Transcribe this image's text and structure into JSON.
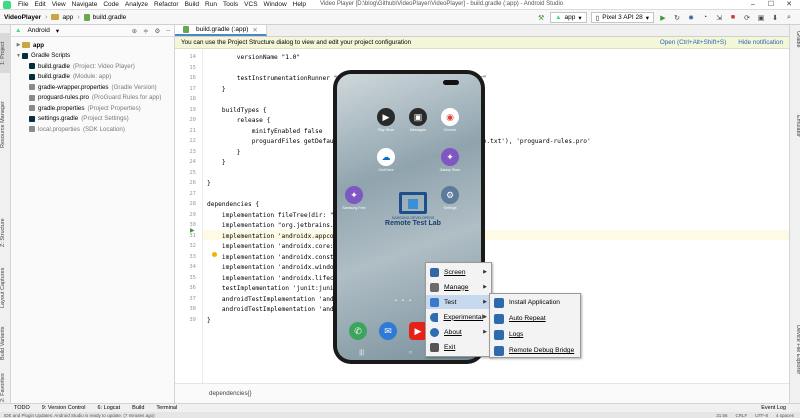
{
  "menubar": {
    "items": [
      "File",
      "Edit",
      "View",
      "Navigate",
      "Code",
      "Analyze",
      "Refactor",
      "Build",
      "Run",
      "Tools",
      "VCS",
      "Window",
      "Help"
    ],
    "window_title": "Video Player [D:\\blog\\Github\\VideoPlayer\\VideoPlayer] - build.gradle (:app) - Android Studio"
  },
  "navbar": {
    "project": "VideoPlayer",
    "module": "app",
    "file": "build.gradle",
    "run_config": "app",
    "device": "Pixel 3 API 28"
  },
  "project_panel": {
    "view_mode": "Android",
    "items": [
      {
        "label": "app",
        "note": "",
        "depth": 0
      },
      {
        "label": "Gradle Scripts",
        "note": "",
        "depth": 0
      },
      {
        "label": "build.gradle",
        "note": "(Project: Video Player)",
        "depth": 1
      },
      {
        "label": "build.gradle",
        "note": "(Module: app)",
        "depth": 1
      },
      {
        "label": "gradle-wrapper.properties",
        "note": "(Gradle Version)",
        "depth": 1
      },
      {
        "label": "proguard-rules.pro",
        "note": "(ProGuard Rules for app)",
        "depth": 1
      },
      {
        "label": "gradle.properties",
        "note": "(Project Properties)",
        "depth": 1
      },
      {
        "label": "settings.gradle",
        "note": "(Project Settings)",
        "depth": 1
      },
      {
        "label": "local.properties",
        "note": "(SDK Location)",
        "depth": 1
      }
    ]
  },
  "left_strip": [
    "1: Project",
    "Resource Manager",
    "Z: Structure",
    "Layout Captures",
    "Build Variants",
    "2: Favorites"
  ],
  "right_strip": [
    "Gradle",
    "Emulator",
    "Device File Explorer"
  ],
  "editor": {
    "tab_label": "build.gradle (:app)",
    "notice": "You can use the Project Structure dialog to view and edit your project configuration",
    "notice_links": [
      "Open (Ctrl+Alt+Shift+S)",
      "Hide notification"
    ],
    "lines": [
      {
        "n": "14",
        "text": "        versionName \"1.0\""
      },
      {
        "n": "15",
        "text": ""
      },
      {
        "n": "16",
        "text": "        testInstrumentationRunner \"androidx.test.runner.AndroidJUnitRunner\""
      },
      {
        "n": "17",
        "text": "    }"
      },
      {
        "n": "18",
        "text": ""
      },
      {
        "n": "19",
        "text": "    buildTypes {"
      },
      {
        "n": "20",
        "text": "        release {"
      },
      {
        "n": "21",
        "text": "            minifyEnabled false"
      },
      {
        "n": "22",
        "text": "            proguardFiles getDefaultProguardFile('proguard-android-optimize.txt'), 'proguard-rules.pro'"
      },
      {
        "n": "23",
        "text": "        }"
      },
      {
        "n": "24",
        "text": "    }"
      },
      {
        "n": "25",
        "text": ""
      },
      {
        "n": "26",
        "text": "}"
      },
      {
        "n": "27",
        "text": ""
      },
      {
        "n": "28",
        "text": "dependencies {"
      },
      {
        "n": "29",
        "text": "    implementation fileTree(dir: \"libs\", include: [\"*.jar\"])"
      },
      {
        "n": "30",
        "text": "    implementation \"org.jetbrains.kotlin:kotlin-stdlib:$kotlin_version\""
      },
      {
        "n": "31",
        "text": "    implementation 'androidx.appcompat:appcompat:1.2.0'"
      },
      {
        "n": "32",
        "text": "    implementation 'androidx.core:core-ktx:1.3.1'"
      },
      {
        "n": "33",
        "text": "    implementation 'androidx.constraintlayout:constraintlayout:2.0.1'"
      },
      {
        "n": "34",
        "text": "    implementation 'androidx.window:window:1.0.0'"
      },
      {
        "n": "35",
        "text": "    implementation 'androidx.lifecycle:lifecycle-runtime:2.2.0'"
      },
      {
        "n": "36",
        "text": "    testImplementation 'junit:junit:4.12'"
      },
      {
        "n": "37",
        "text": "    androidTestImplementation 'androidx.test.ext:junit:1.1.2'"
      },
      {
        "n": "38",
        "text": "    androidTestImplementation 'androidx.test.espresso:espresso-core:3.3.0'"
      },
      {
        "n": "39",
        "text": "}"
      }
    ],
    "bottom_crumb": "dependencies{}"
  },
  "bottom_tools": [
    "TODO",
    "9: Version Control",
    "6: Logcat",
    "Build",
    "Terminal"
  ],
  "event_log": "Event Log",
  "status": {
    "message": "IDE and Plugin Updates: Android Studio is ready to update. (7 minutes ago)",
    "position": "31:56",
    "line_sep": "CRLF",
    "encoding": "UTF-8",
    "indent": "4 spaces"
  },
  "phone": {
    "apps": [
      {
        "label": "Play Store",
        "color": "#2a2a2a",
        "glyph": "▶"
      },
      {
        "label": "Messages",
        "color": "#2a2a2a",
        "glyph": "▣"
      },
      {
        "label": "Chrome",
        "color": "#ffffff",
        "glyph": "◉"
      },
      {
        "label": "OneDrive",
        "color": "#ffffff",
        "glyph": "☁"
      },
      {
        "label": "Samsung Free",
        "color": "#7e57c2",
        "glyph": "✦"
      },
      {
        "label": "Galaxy Store",
        "color": "#7e57c2",
        "glyph": "✦"
      },
      {
        "label": "Settings",
        "color": "#5c7a99",
        "glyph": "⚙"
      }
    ],
    "logo_caption": "SAMSUNG DEVELOPERS",
    "logo_title": "Remote Test Lab",
    "dock": [
      {
        "label": "Phone",
        "color": "#3ba55c",
        "glyph": "✆"
      },
      {
        "label": "Messages",
        "color": "#2f7ad6",
        "glyph": "✉"
      },
      {
        "label": "YouTube",
        "color": "#e62117",
        "glyph": "▶"
      }
    ]
  },
  "context_menu": {
    "items": [
      {
        "label": "Screen",
        "has_sub": true,
        "color": "#3567a8"
      },
      {
        "label": "Manage",
        "has_sub": true,
        "color": "#6b6b6b"
      },
      {
        "label": "Test",
        "has_sub": true,
        "color": "#3b7ac9"
      },
      {
        "label": "Experimental",
        "has_sub": true,
        "color": "#2e6db4"
      },
      {
        "label": "About",
        "has_sub": true,
        "color": "#2e6db4"
      },
      {
        "label": "Exit",
        "has_sub": false,
        "color": "#555555"
      }
    ],
    "selected": "Test",
    "submenu": [
      {
        "label": "Install Application",
        "color": "#2f6aad"
      },
      {
        "label": "Auto Repeat",
        "color": "#2f6aad"
      },
      {
        "label": "Logs",
        "color": "#2f6aad"
      },
      {
        "label": "Remote Debug Bridge",
        "color": "#2f6aad"
      }
    ]
  }
}
